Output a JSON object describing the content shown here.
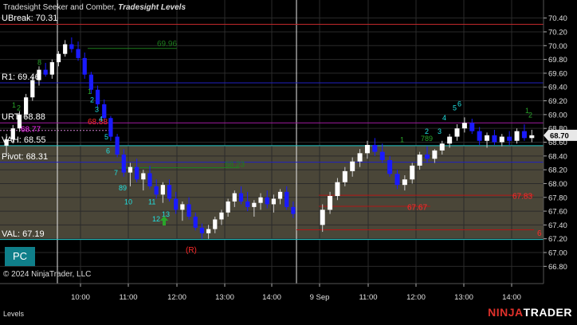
{
  "header": {
    "indicators": "Tradesight Seeker and Comber,",
    "levels_name": "Tradesight Levels"
  },
  "copyright": "© 2024 NinjaTrader, LLC",
  "footer_tab": "Levels",
  "brand": {
    "prefix": "NINJA",
    "suffix": "TRADER"
  },
  "pc_button": "PC",
  "colors": {
    "up_candle": "#ffffff",
    "down_candle": "#1a1aff",
    "value_area_fill": "#4a4638",
    "ubreak": "#c0282b",
    "r1": "#2020c0",
    "urt": "#a01aa0",
    "vah": "#21c7c7",
    "pivot": "#2020c0",
    "val": "#21c7c7",
    "red_level": "#b01616",
    "green_level": "#1e7d1e",
    "seeker_green": "#2aa52a",
    "comber_cyan": "#21e0e0",
    "comber_red": "#ff2a2a",
    "magenta": "#ff2aff"
  },
  "chart_data": {
    "type": "candlestick",
    "y_axis": {
      "min": 66.7,
      "max": 70.5,
      "ticks": [
        "70.40",
        "70.20",
        "70.00",
        "69.80",
        "69.60",
        "69.40",
        "69.20",
        "69.00",
        "68.80",
        "68.60",
        "68.40",
        "68.20",
        "68.00",
        "67.80",
        "67.60",
        "67.40",
        "67.20",
        "67.00",
        "66.80"
      ],
      "current_price": "68.70"
    },
    "x_axis": {
      "ticks": [
        "10:00",
        "11:00",
        "12:00",
        "13:00",
        "14:00",
        "9 Sep",
        "11:00",
        "12:00",
        "13:00",
        "14:00"
      ]
    },
    "levels": [
      {
        "label": "UBreak: 70.31",
        "value": 70.31,
        "color_key": "ubreak"
      },
      {
        "label": "R1: 69.46",
        "value": 69.46,
        "color_key": "r1"
      },
      {
        "label": "URT: 68.88",
        "value": 68.88,
        "color_key": "urt"
      },
      {
        "label": "VAH: 68.55",
        "value": 68.55,
        "color_key": "vah"
      },
      {
        "label": "Pivot: 68.31",
        "value": 68.31,
        "color_key": "pivot"
      },
      {
        "label": "VAL: 67.19",
        "value": 67.19,
        "color_key": "val"
      }
    ],
    "value_labels": [
      {
        "text": "69.96",
        "color_key": "green_level"
      },
      {
        "text": "68.77",
        "color_key": "magenta"
      },
      {
        "text": "68.88",
        "color_key": "comber_red"
      },
      {
        "text": "68.23",
        "color_key": "green_level"
      },
      {
        "text": "67.67",
        "color_key": "comber_red"
      },
      {
        "text": "67.83",
        "color_key": "comber_red"
      },
      {
        "text": "6",
        "color_key": "comber_red"
      },
      {
        "text": "(R)",
        "color_key": "comber_red"
      }
    ],
    "counts": [
      "8",
      "1",
      "2",
      "3",
      "4",
      "5",
      "6",
      "7",
      "8",
      "9",
      "10",
      "11",
      "12",
      "13",
      "1",
      "2",
      "3",
      "4",
      "5",
      "6",
      "1",
      "2",
      "1",
      "2",
      "789"
    ],
    "sessions": [
      {
        "name": "day1",
        "candles": [
          [
            68.55,
            68.72,
            68.4,
            68.64
          ],
          [
            68.64,
            68.85,
            68.58,
            68.8
          ],
          [
            68.8,
            69.05,
            68.75,
            69.0
          ],
          [
            69.0,
            69.3,
            68.95,
            69.25
          ],
          [
            69.25,
            69.55,
            69.2,
            69.5
          ],
          [
            69.5,
            69.7,
            69.42,
            69.65
          ],
          [
            69.65,
            69.75,
            69.55,
            69.58
          ],
          [
            69.58,
            69.8,
            69.52,
            69.76
          ],
          [
            69.76,
            69.92,
            69.7,
            69.88
          ],
          [
            69.88,
            70.08,
            69.84,
            70.02
          ],
          [
            70.02,
            70.12,
            69.9,
            69.95
          ],
          [
            69.95,
            70.06,
            69.78,
            69.82
          ],
          [
            69.82,
            69.9,
            69.52,
            69.58
          ],
          [
            69.58,
            69.62,
            69.3,
            69.36
          ],
          [
            69.36,
            69.42,
            69.1,
            69.15
          ],
          [
            69.15,
            69.22,
            68.9,
            68.95
          ],
          [
            68.95,
            68.98,
            68.62,
            68.68
          ],
          [
            68.68,
            68.72,
            68.38,
            68.42
          ],
          [
            68.42,
            68.5,
            68.1,
            68.16
          ],
          [
            68.16,
            68.3,
            67.96,
            68.24
          ],
          [
            68.24,
            68.36,
            68.02,
            68.06
          ],
          [
            68.06,
            68.2,
            67.9,
            68.15
          ],
          [
            68.15,
            68.26,
            67.92,
            67.96
          ],
          [
            67.96,
            68.06,
            67.78,
            67.84
          ],
          [
            67.84,
            68.02,
            67.72,
            67.98
          ],
          [
            67.98,
            68.06,
            67.74,
            67.78
          ],
          [
            67.78,
            67.88,
            67.56,
            67.62
          ],
          [
            67.62,
            67.74,
            67.46,
            67.7
          ],
          [
            67.7,
            67.8,
            67.48,
            67.52
          ],
          [
            67.52,
            67.58,
            67.32,
            67.36
          ],
          [
            67.36,
            67.42,
            67.2,
            67.28
          ],
          [
            67.28,
            67.4,
            67.2,
            67.34
          ],
          [
            67.34,
            67.52,
            67.28,
            67.48
          ],
          [
            67.48,
            67.62,
            67.4,
            67.58
          ],
          [
            67.58,
            67.78,
            67.52,
            67.74
          ],
          [
            67.74,
            67.9,
            67.66,
            67.86
          ],
          [
            67.86,
            67.96,
            67.7,
            67.74
          ],
          [
            67.74,
            67.88,
            67.6,
            67.66
          ],
          [
            67.66,
            67.76,
            67.52,
            67.72
          ],
          [
            67.72,
            67.86,
            67.62,
            67.8
          ],
          [
            67.8,
            67.9,
            67.64,
            67.7
          ],
          [
            67.7,
            67.84,
            67.58,
            67.78
          ],
          [
            67.78,
            67.92,
            67.7,
            67.88
          ],
          [
            67.88,
            67.96,
            67.62,
            67.66
          ],
          [
            67.66,
            67.74,
            67.5,
            67.56
          ]
        ]
      },
      {
        "name": "day2",
        "candles": [
          [
            67.4,
            67.7,
            67.3,
            67.62
          ],
          [
            67.62,
            67.88,
            67.56,
            67.82
          ],
          [
            67.82,
            68.08,
            67.76,
            68.02
          ],
          [
            68.02,
            68.24,
            67.96,
            68.18
          ],
          [
            68.18,
            68.38,
            68.1,
            68.32
          ],
          [
            68.32,
            68.5,
            68.24,
            68.44
          ],
          [
            68.44,
            68.62,
            68.36,
            68.56
          ],
          [
            68.56,
            68.66,
            68.4,
            68.46
          ],
          [
            68.46,
            68.58,
            68.3,
            68.34
          ],
          [
            68.34,
            68.4,
            68.1,
            68.14
          ],
          [
            68.14,
            68.2,
            67.92,
            67.98
          ],
          [
            67.98,
            68.12,
            67.9,
            68.06
          ],
          [
            68.06,
            68.3,
            68.0,
            68.26
          ],
          [
            68.26,
            68.46,
            68.2,
            68.42
          ],
          [
            68.42,
            68.54,
            68.3,
            68.36
          ],
          [
            68.36,
            68.5,
            68.3,
            68.48
          ],
          [
            68.48,
            68.62,
            68.42,
            68.58
          ],
          [
            68.58,
            68.72,
            68.52,
            68.68
          ],
          [
            68.68,
            68.86,
            68.62,
            68.8
          ],
          [
            68.8,
            68.96,
            68.74,
            68.88
          ],
          [
            68.88,
            68.94,
            68.72,
            68.76
          ],
          [
            68.76,
            68.82,
            68.56,
            68.62
          ],
          [
            68.62,
            68.74,
            68.52,
            68.7
          ],
          [
            68.7,
            68.78,
            68.56,
            68.6
          ],
          [
            68.6,
            68.72,
            68.54,
            68.68
          ],
          [
            68.68,
            68.76,
            68.56,
            68.62
          ],
          [
            68.62,
            68.8,
            68.58,
            68.76
          ],
          [
            68.76,
            68.86,
            68.62,
            68.66
          ],
          [
            68.66,
            68.78,
            68.6,
            68.7
          ]
        ]
      }
    ]
  }
}
